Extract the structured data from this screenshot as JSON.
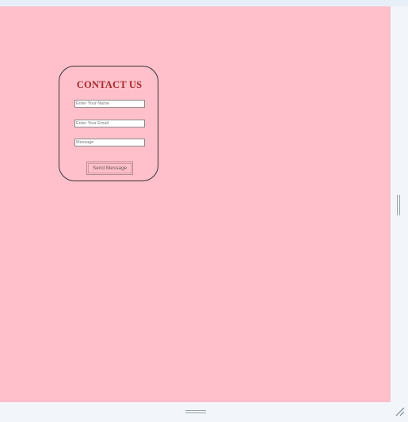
{
  "form": {
    "title": "CONTACT US",
    "name_placeholder": "Enter Your Name",
    "email_placeholder": "Enter Your Email",
    "message_placeholder": "Message",
    "submit_label": "Send Message"
  },
  "colors": {
    "page_background": "#ffc0cb",
    "title_color": "#a42a2a",
    "frame_background": "#f2f6fb"
  },
  "icons": {
    "resize_grip": "resize-grip-icon"
  }
}
